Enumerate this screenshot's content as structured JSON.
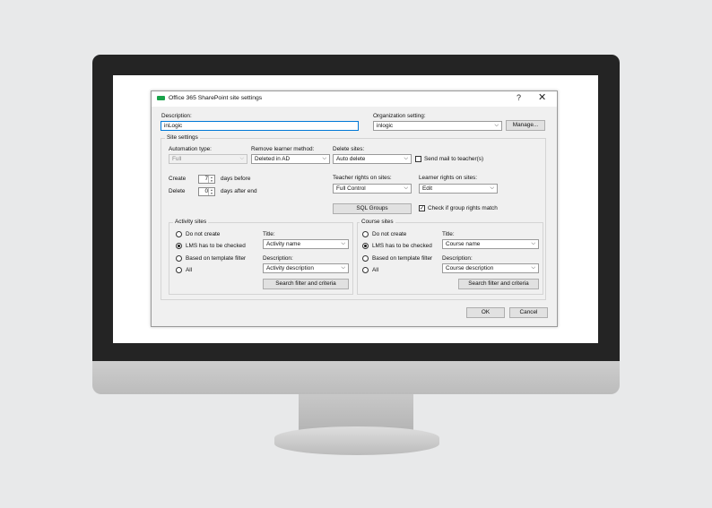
{
  "window": {
    "title": "Office 365 SharePoint site settings",
    "help_glyph": "?",
    "close_glyph": "✕"
  },
  "description": {
    "label": "Description:",
    "value": "inLogic"
  },
  "organization": {
    "label": "Organization setting:",
    "value": "inlogic",
    "manage_label": "Manage..."
  },
  "site_settings": {
    "label": "Site settings",
    "automation_type": {
      "label": "Automation type:",
      "value": "Full"
    },
    "remove_learner": {
      "label": "Remove learner method:",
      "value": "Deleted in AD"
    },
    "delete_sites": {
      "label": "Delete sites:",
      "value": "Auto delete"
    },
    "send_mail": {
      "label": "Send mail to teacher(s)",
      "checked": false
    },
    "create": {
      "label": "Create",
      "value": "7",
      "suffix": "days before"
    },
    "delete": {
      "label": "Delete",
      "value": "0",
      "suffix": "days after end"
    },
    "teacher_rights": {
      "label": "Teacher rights on sites:",
      "value": "Full Control"
    },
    "learner_rights": {
      "label": "Learner rights on sites:",
      "value": "Edit"
    },
    "sql_groups_label": "SQL Groups",
    "check_group_rights": {
      "label": "Check if group rights match",
      "checked": true,
      "mark": "✓"
    }
  },
  "activity_sites": {
    "label": "Activity sites",
    "options": [
      "Do not create",
      "LMS has to be checked",
      "Based on template filter",
      "All"
    ],
    "selected": 1,
    "title_label": "Title:",
    "title_value": "Activity name",
    "description_label": "Description:",
    "description_value": "Activity description",
    "search_label": "Search filter and criteria"
  },
  "course_sites": {
    "label": "Course sites",
    "options": [
      "Do not create",
      "LMS has to be checked",
      "Based on template filter",
      "All"
    ],
    "selected": 1,
    "title_label": "Title:",
    "title_value": "Course name",
    "description_label": "Description:",
    "description_value": "Course description",
    "search_label": "Search filter and criteria"
  },
  "footer": {
    "ok_label": "OK",
    "cancel_label": "Cancel"
  },
  "icons": {
    "chevron": "⌵",
    "spin_up": "▲",
    "spin_down": "▼"
  },
  "colors": {
    "app_icon": "#19a34a",
    "focus_border": "#0078d7"
  }
}
